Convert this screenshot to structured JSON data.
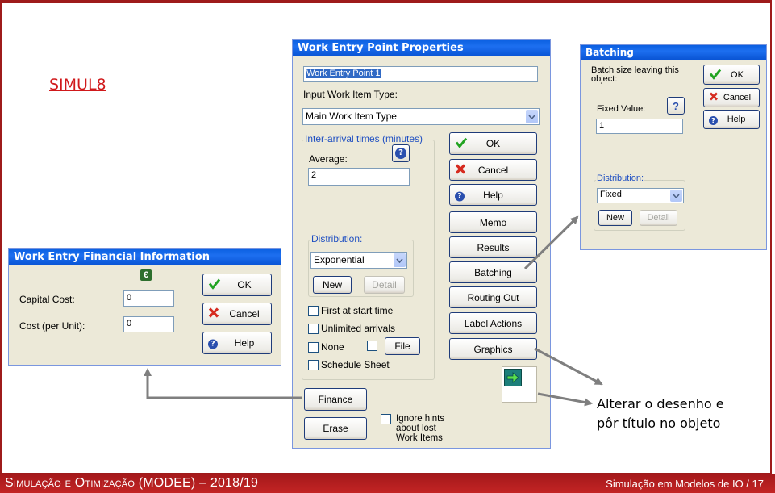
{
  "slide": {
    "heading": "SIMUL8",
    "footer_left": "Simulação e Otimização (MODEE) – 2018/19",
    "footer_right": "Simulação em Modelos de IO / 17",
    "annotation_line1": "Alterar o desenho e",
    "annotation_line2": "pôr título no objeto"
  },
  "colors": {
    "brand_red": "#b31e1f",
    "titlebar_blue": "#0a5fe0",
    "dialog_bg": "#ece9d8",
    "group_label_blue": "#1f4fc2"
  },
  "work_entry": {
    "title": "Work Entry Point Properties",
    "name_value": "Work Entry Point 1",
    "input_type_label": "Input Work Item Type:",
    "input_type_value": "Main Work Item Type",
    "interarrival_label": "Inter-arrival times (minutes)",
    "average_label": "Average:",
    "average_value": "2",
    "distribution_label": "Distribution:",
    "distribution_value": "Exponential",
    "new_label": "New",
    "detail_label": "Detail",
    "first_at_start": "First at start time",
    "unlimited_arrivals": "Unlimited arrivals",
    "none_label": "None",
    "file_label": "File",
    "schedule_sheet": "Schedule Sheet",
    "ok_label": "OK",
    "cancel_label": "Cancel",
    "help_label": "Help",
    "memo_label": "Memo",
    "results_label": "Results",
    "batching_label": "Batching",
    "routing_out_label": "Routing Out",
    "label_actions_label": "Label Actions",
    "graphics_label": "Graphics",
    "finance_label": "Finance",
    "erase_label": "Erase",
    "ignore_hints_line1": "Ignore hints",
    "ignore_hints_line2": "about lost",
    "ignore_hints_line3": "Work Items"
  },
  "financial": {
    "title": "Work Entry Financial Information",
    "capital_cost_label": "Capital Cost:",
    "capital_cost_value": "0",
    "cost_per_unit_label": "Cost (per Unit):",
    "cost_per_unit_value": "0",
    "ok_label": "OK",
    "cancel_label": "Cancel",
    "help_label": "Help"
  },
  "batching": {
    "title": "Batching",
    "batch_size_line1": "Batch size leaving this",
    "batch_size_line2": "object:",
    "fixed_value_label": "Fixed Value:",
    "fixed_value": "1",
    "distribution_label": "Distribution:",
    "distribution_value": "Fixed",
    "new_label": "New",
    "detail_label": "Detail",
    "ok_label": "OK",
    "cancel_label": "Cancel",
    "help_label": "Help"
  },
  "icons": {
    "ok": "green-check-icon",
    "cancel": "red-x-icon",
    "help": "blue-question-icon",
    "euro": "euro-icon",
    "graphics": "green-arrow-icon"
  }
}
